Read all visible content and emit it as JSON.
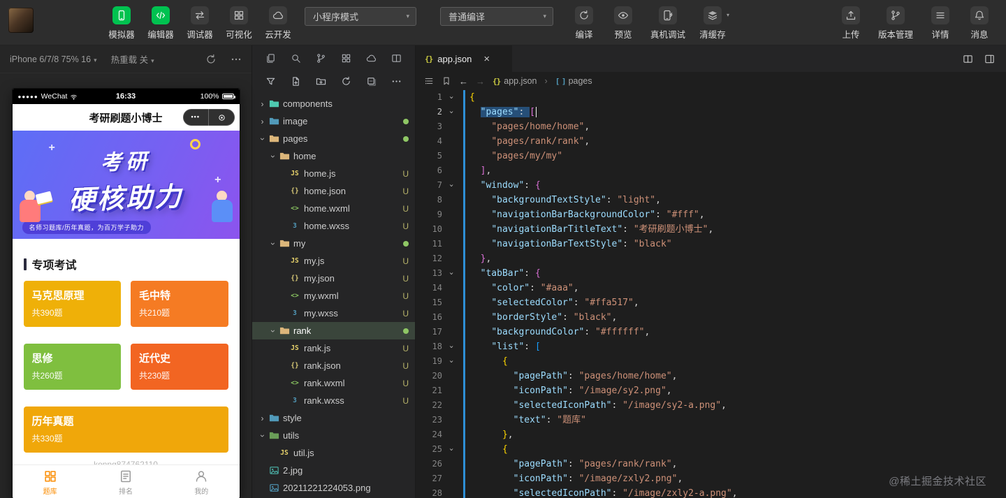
{
  "toolbar": {
    "left_tools": [
      {
        "key": "simulator",
        "label": "模拟器",
        "icon": "phone-icon",
        "green": true
      },
      {
        "key": "editor",
        "label": "编辑器",
        "icon": "code-icon",
        "green": true
      },
      {
        "key": "debugger",
        "label": "调试器",
        "icon": "swap-icon",
        "green": false
      },
      {
        "key": "visualizer",
        "label": "可视化",
        "icon": "grid-icon",
        "green": false
      },
      {
        "key": "cloud-dev",
        "label": "云开发",
        "icon": "cloud-icon",
        "green": false
      }
    ],
    "mode_select": "小程序模式",
    "compile_select": "普通编译",
    "compile_actions": [
      {
        "key": "compile",
        "label": "编译",
        "icon": "refresh-icon"
      },
      {
        "key": "preview",
        "label": "预览",
        "icon": "eye-icon"
      },
      {
        "key": "device-debug",
        "label": "真机调试",
        "icon": "device-debug-icon",
        "wide": true
      },
      {
        "key": "clear-cache",
        "label": "清缓存",
        "icon": "clear-cache-icon",
        "caret": true
      }
    ],
    "right_actions": [
      {
        "key": "upload",
        "label": "上传",
        "icon": "upload-icon"
      },
      {
        "key": "version",
        "label": "版本管理",
        "icon": "branch-icon",
        "wide": true
      },
      {
        "key": "details",
        "label": "详情",
        "icon": "menu-icon"
      },
      {
        "key": "messages",
        "label": "消息",
        "icon": "bell-icon"
      }
    ]
  },
  "simulator": {
    "device_label": "iPhone 6/7/8 75% 16",
    "hot_reload_label": "热重载 关",
    "phone": {
      "status_bar": {
        "signal": "●●●●●",
        "carrier": "WeChat",
        "time": "16:33",
        "battery": "100%"
      },
      "nav_title": "考研刷题小博士",
      "banner": {
        "line1": "考研",
        "line2": "硬核助力",
        "ribbon": "名师习题库/历年真题，为百万学子助力"
      },
      "section_title": "专项考试",
      "cards": [
        {
          "title": "马克思原理",
          "count": "共390题",
          "color": "#efb008"
        },
        {
          "title": "毛中特",
          "count": "共210题",
          "color": "#f57b23"
        },
        {
          "title": "思修",
          "count": "共260题",
          "color": "#7fbf3f"
        },
        {
          "title": "近代史",
          "count": "共230题",
          "color": "#f26522"
        },
        {
          "title": "历年真题",
          "count": "共330题",
          "color": "#f0a70a",
          "wide": true
        }
      ],
      "watermark": "konng874762110",
      "tabbar": [
        {
          "label": "题库",
          "icon": "grid-icon",
          "active": true
        },
        {
          "label": "排名",
          "icon": "doc-icon",
          "active": false
        },
        {
          "label": "我的",
          "icon": "person-icon",
          "active": false
        }
      ]
    }
  },
  "explorer": {
    "activity_icons": [
      "files-icon",
      "search-icon",
      "branch-icon",
      "extensions-icon",
      "cloud-icon",
      "splitpane-icon"
    ],
    "action_icons": [
      "filter-icon",
      "new-file-icon",
      "new-folder-icon",
      "refresh-icon",
      "collapse-all-icon",
      "more-icon"
    ],
    "tree": [
      {
        "name": "components",
        "kind": "folder",
        "color": "#4ec9b0",
        "level": 0,
        "state": "collapsed"
      },
      {
        "name": "image",
        "kind": "folder",
        "color": "#519aba",
        "level": 0,
        "state": "collapsed",
        "dot": true
      },
      {
        "name": "pages",
        "kind": "folder",
        "color": "#dcb67a",
        "level": 0,
        "state": "expanded",
        "dot": true
      },
      {
        "name": "home",
        "kind": "folder",
        "color": "#dcb67a",
        "level": 1,
        "state": "expanded"
      },
      {
        "name": "home.js",
        "kind": "js",
        "level": 2,
        "badge": "U"
      },
      {
        "name": "home.json",
        "kind": "json",
        "level": 2,
        "badge": "U"
      },
      {
        "name": "home.wxml",
        "kind": "wxml",
        "level": 2,
        "badge": "U"
      },
      {
        "name": "home.wxss",
        "kind": "wxss",
        "level": 2,
        "badge": "U"
      },
      {
        "name": "my",
        "kind": "folder",
        "color": "#dcb67a",
        "level": 1,
        "state": "expanded",
        "dot": true
      },
      {
        "name": "my.js",
        "kind": "js",
        "level": 2,
        "badge": "U"
      },
      {
        "name": "my.json",
        "kind": "json",
        "level": 2,
        "badge": "U"
      },
      {
        "name": "my.wxml",
        "kind": "wxml",
        "level": 2,
        "badge": "U"
      },
      {
        "name": "my.wxss",
        "kind": "wxss",
        "level": 2,
        "badge": "U"
      },
      {
        "name": "rank",
        "kind": "folder",
        "color": "#dcb67a",
        "level": 1,
        "state": "expanded",
        "dot": true,
        "selected": true
      },
      {
        "name": "rank.js",
        "kind": "js",
        "level": 2,
        "badge": "U"
      },
      {
        "name": "rank.json",
        "kind": "json",
        "level": 2,
        "badge": "U"
      },
      {
        "name": "rank.wxml",
        "kind": "wxml",
        "level": 2,
        "badge": "U"
      },
      {
        "name": "rank.wxss",
        "kind": "wxss",
        "level": 2,
        "badge": "U"
      },
      {
        "name": "style",
        "kind": "folder",
        "color": "#519aba",
        "level": 0,
        "state": "collapsed"
      },
      {
        "name": "utils",
        "kind": "folder",
        "color": "#6a9e58",
        "level": 0,
        "state": "expanded"
      },
      {
        "name": "util.js",
        "kind": "js",
        "level": 1
      },
      {
        "name": "2.jpg",
        "kind": "imagefile",
        "color": "#4db6ac",
        "level": 0
      },
      {
        "name": "20211221224053.png",
        "kind": "imagefile",
        "color": "#519aba",
        "level": 0
      }
    ]
  },
  "editor": {
    "tab_name": "app.json",
    "breadcrumb": {
      "file": "app.json",
      "symbol": "pages"
    },
    "watermark": "@稀土掘金技术社区",
    "code_lines": [
      {
        "n": 1,
        "t": "{",
        "fold": true
      },
      {
        "n": 2,
        "t": "  \"pages\": [",
        "fold": true,
        "sel": true,
        "active": true
      },
      {
        "n": 3,
        "t": "    \"pages/home/home\","
      },
      {
        "n": 4,
        "t": "    \"pages/rank/rank\","
      },
      {
        "n": 5,
        "t": "    \"pages/my/my\""
      },
      {
        "n": 6,
        "t": "  ],"
      },
      {
        "n": 7,
        "t": "  \"window\": {",
        "fold": true
      },
      {
        "n": 8,
        "t": "    \"backgroundTextStyle\": \"light\","
      },
      {
        "n": 9,
        "t": "    \"navigationBarBackgroundColor\": \"#fff\","
      },
      {
        "n": 10,
        "t": "    \"navigationBarTitleText\": \"考研刷题小博士\","
      },
      {
        "n": 11,
        "t": "    \"navigationBarTextStyle\": \"black\""
      },
      {
        "n": 12,
        "t": "  },"
      },
      {
        "n": 13,
        "t": "  \"tabBar\": {",
        "fold": true
      },
      {
        "n": 14,
        "t": "    \"color\": \"#aaa\","
      },
      {
        "n": 15,
        "t": "    \"selectedColor\": \"#ffa517\","
      },
      {
        "n": 16,
        "t": "    \"borderStyle\": \"black\","
      },
      {
        "n": 17,
        "t": "    \"backgroundColor\": \"#ffffff\","
      },
      {
        "n": 18,
        "t": "    \"list\": [",
        "fold": true
      },
      {
        "n": 19,
        "t": "      {",
        "fold": true
      },
      {
        "n": 20,
        "t": "        \"pagePath\": \"pages/home/home\","
      },
      {
        "n": 21,
        "t": "        \"iconPath\": \"/image/sy2.png\","
      },
      {
        "n": 22,
        "t": "        \"selectedIconPath\": \"/image/sy2-a.png\","
      },
      {
        "n": 23,
        "t": "        \"text\": \"题库\""
      },
      {
        "n": 24,
        "t": "      },"
      },
      {
        "n": 25,
        "t": "      {",
        "fold": true
      },
      {
        "n": 26,
        "t": "        \"pagePath\": \"pages/rank/rank\","
      },
      {
        "n": 27,
        "t": "        \"iconPath\": \"/image/zxly2.png\","
      },
      {
        "n": 28,
        "t": "        \"selectedIconPath\": \"/image/zxly2-a.png\","
      }
    ]
  }
}
